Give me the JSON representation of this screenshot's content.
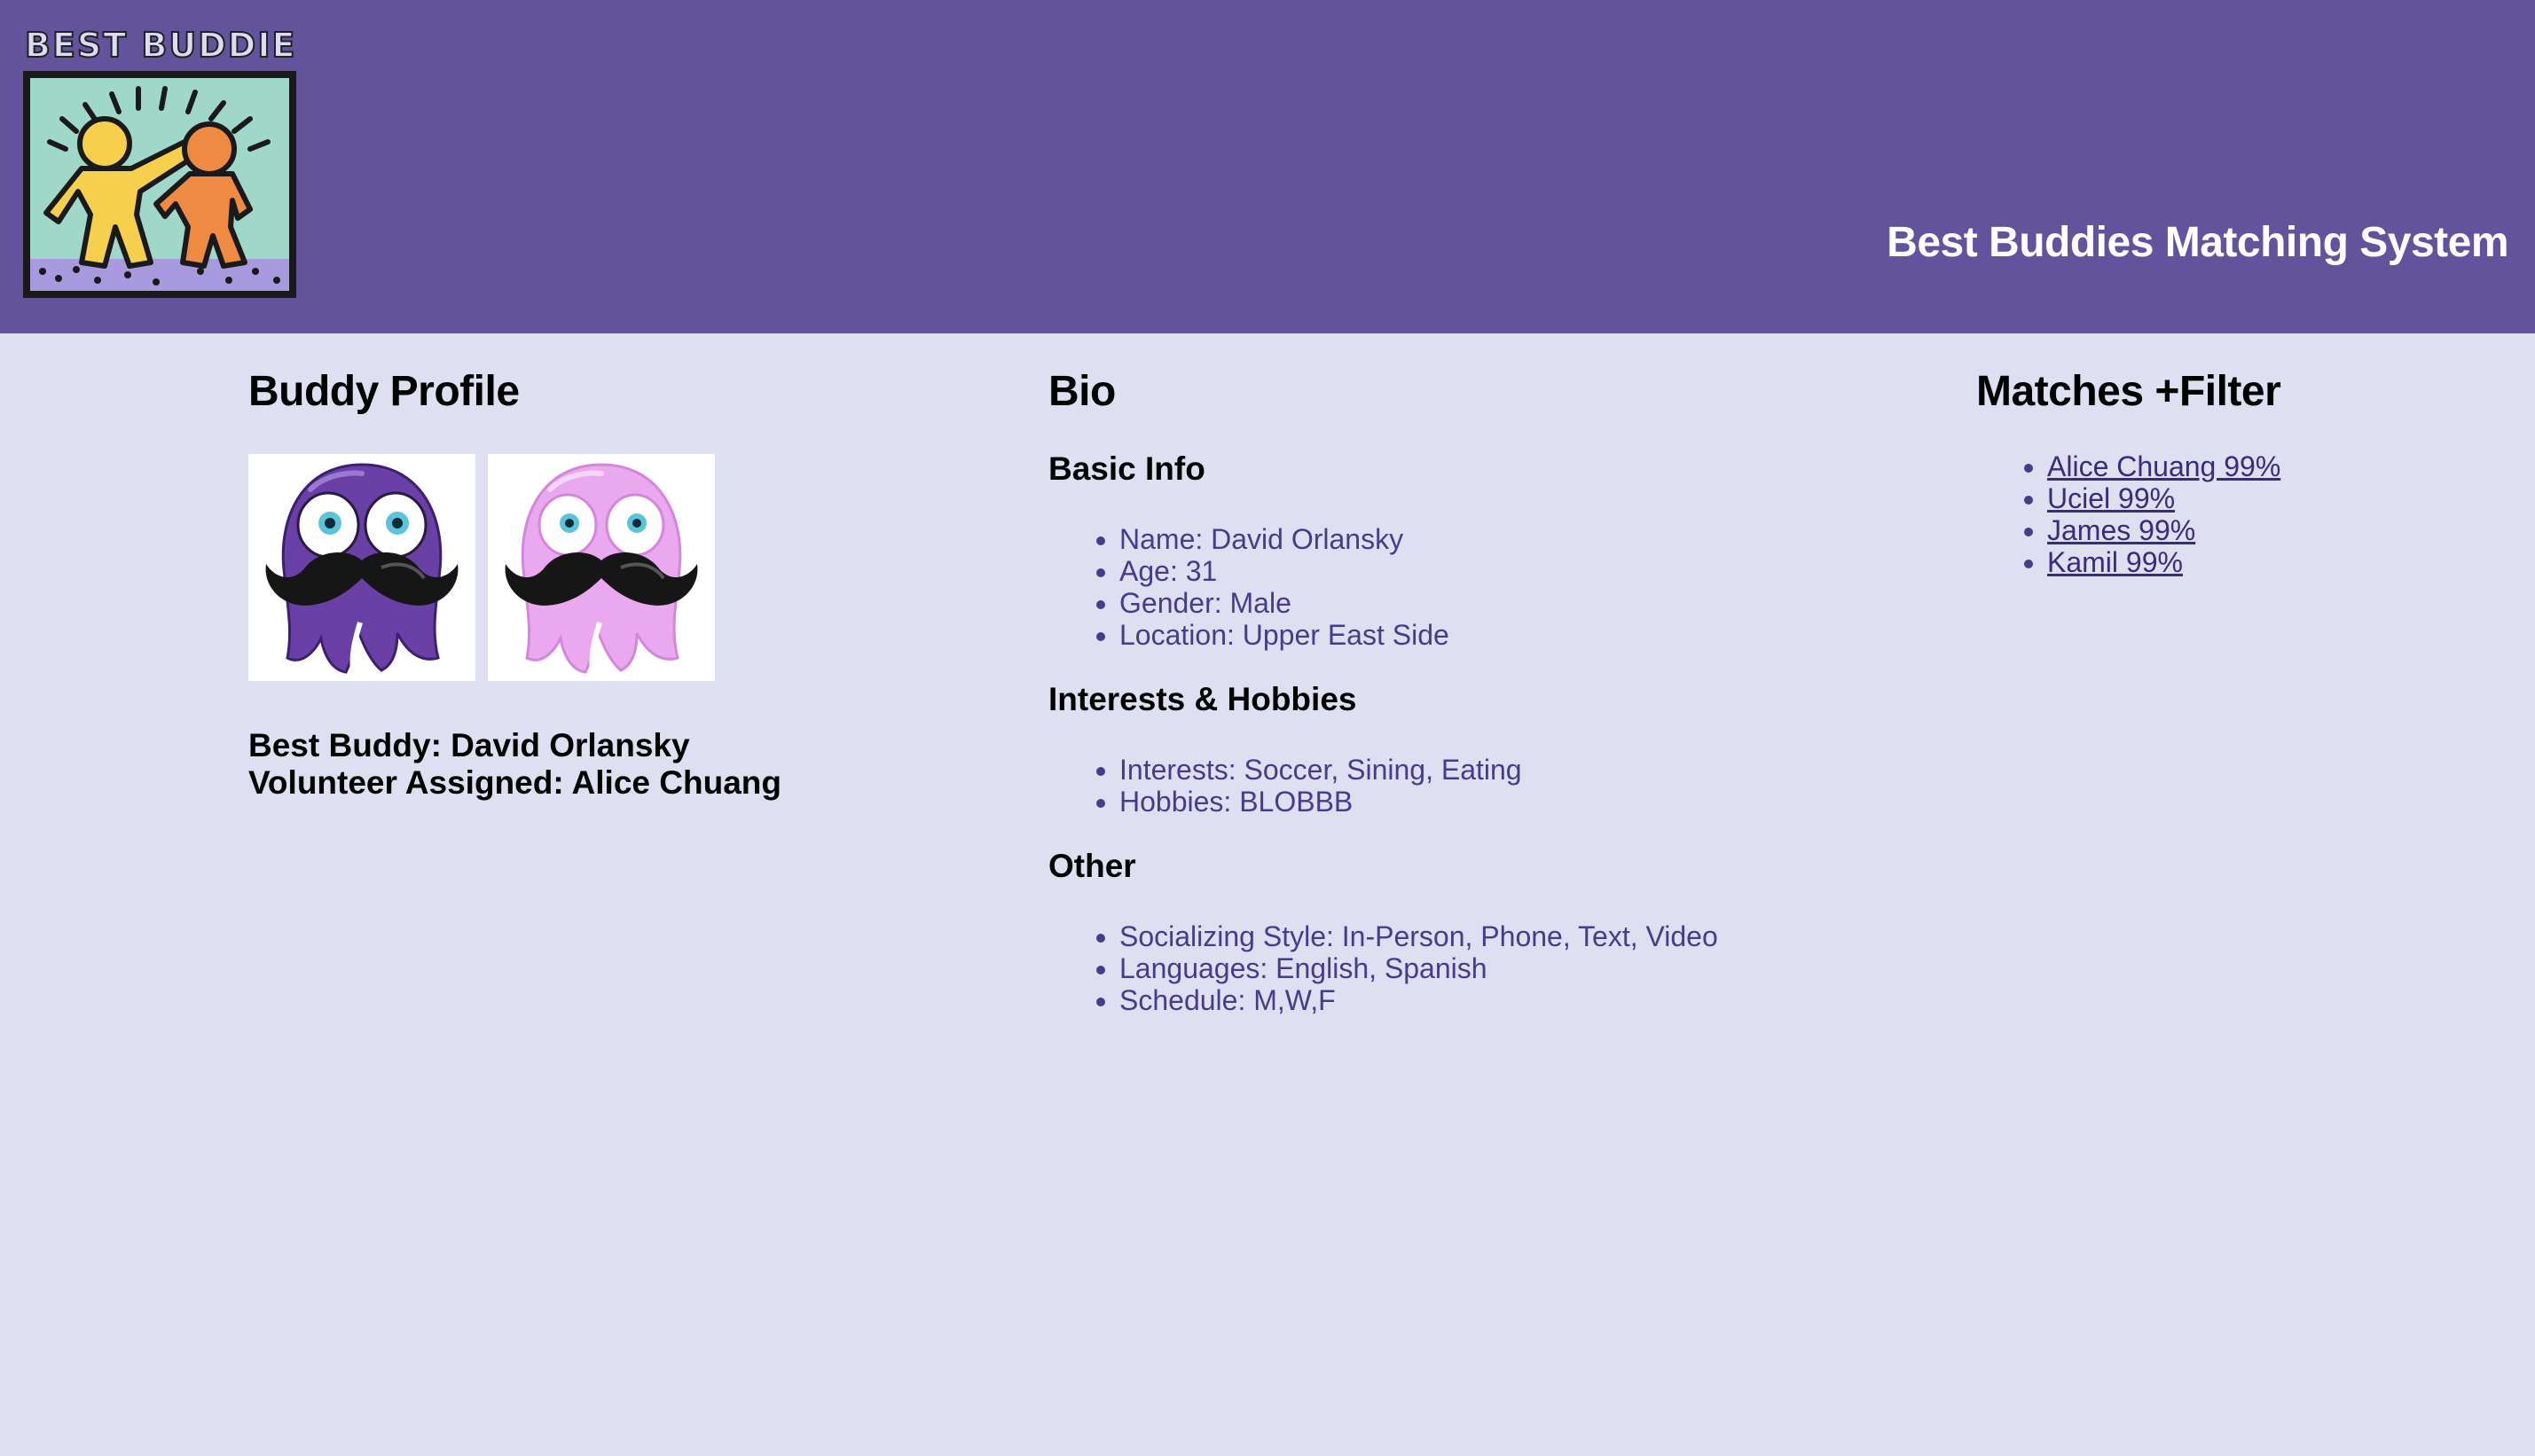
{
  "header": {
    "logo_text": "BEST BUDDIES",
    "title": "Best Buddies Matching System",
    "background": "#62539c"
  },
  "profile": {
    "heading": "Buddy Profile",
    "images": [
      {
        "icon": "purple-octopus-mustache-avatar",
        "color": "#6a3fa6"
      },
      {
        "icon": "pink-octopus-mustache-avatar",
        "color": "#e7a6ee"
      }
    ],
    "best_buddy_label": "Best Buddy: David Orlansky",
    "volunteer_label": "Volunteer Assigned: Alice Chuang"
  },
  "bio": {
    "heading": "Bio",
    "sections": [
      {
        "title": "Basic Info",
        "items": [
          "Name: David Orlansky",
          "Age: 31",
          "Gender: Male",
          "Location: Upper East Side"
        ]
      },
      {
        "title": "Interests & Hobbies",
        "items": [
          "Interests: Soccer, Sining, Eating",
          "Hobbies: BLOBBB"
        ]
      },
      {
        "title": "Other",
        "items": [
          "Socializing Style: In-Person, Phone, Text, Video",
          "Languages: English, Spanish",
          "Schedule: M,W,F"
        ]
      }
    ]
  },
  "matches": {
    "heading": "Matches +Filter",
    "items": [
      "Alice Chuang 99%",
      "Uciel 99%",
      "James 99%",
      "Kamil 99%"
    ]
  },
  "colors": {
    "page_bg": "#dedff0",
    "list_text": "#4a3a8c",
    "link": "#3d2a7a"
  }
}
